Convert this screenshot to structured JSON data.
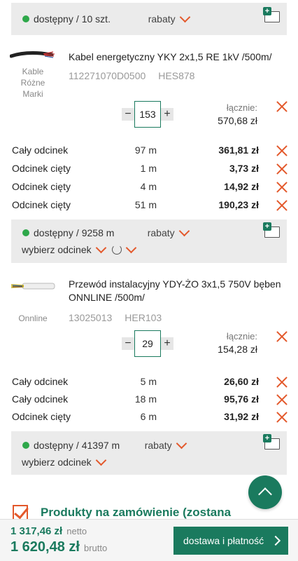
{
  "stock_bars": [
    {
      "status": "dostępny",
      "stock": "10 szt.",
      "discount": "rabaty"
    },
    {
      "status": "dostępny",
      "stock": "9258 m",
      "discount": "rabaty",
      "segment_select": "wybierz odcinek"
    },
    {
      "status": "dostępny",
      "stock": "41397 m",
      "discount": "rabaty",
      "segment_select": "wybierz odcinek"
    }
  ],
  "products": [
    {
      "name": "Kabel energetyczny YKY 2x1,5 RE 1kV /500m/",
      "brand": "Kable\nRóżne\nMarki",
      "code": "112271070D0500",
      "sku": "HES878",
      "quantity": "153",
      "total_label": "łącznie:",
      "total_value": "570,68 zł",
      "segments": [
        {
          "name": "Cały odcinek",
          "length": "97 m",
          "price": "361,81 zł"
        },
        {
          "name": "Odcinek cięty",
          "length": "1 m",
          "price": "3,73 zł"
        },
        {
          "name": "Odcinek cięty",
          "length": "4 m",
          "price": "14,92 zł"
        },
        {
          "name": "Odcinek cięty",
          "length": "51 m",
          "price": "190,23 zł"
        }
      ]
    },
    {
      "name": "Przewód instalacyjny YDY-ŻO 3x1,5 750V bęben ONNLINE /500m/",
      "brand": "Onnline",
      "code": "13025013",
      "sku": "HER103",
      "quantity": "29",
      "total_label": "łącznie:",
      "total_value": "154,28 zł",
      "segments": [
        {
          "name": "Cały odcinek",
          "length": "5 m",
          "price": "26,60 zł"
        },
        {
          "name": "Cały odcinek",
          "length": "18 m",
          "price": "95,76 zł"
        },
        {
          "name": "Odcinek cięty",
          "length": "6 m",
          "price": "31,92 zł"
        }
      ]
    }
  ],
  "order_section": {
    "title": "Produkty na zamówienie (zostana"
  },
  "footer": {
    "netto_value": "1 317,46 zł",
    "netto_label": "netto",
    "brutto_value": "1 620,48 zł",
    "brutto_label": "brutto",
    "checkout_label": "dostawa i płatność"
  },
  "colors": {
    "accent": "#1a7a5e",
    "danger": "#e3582b",
    "available": "#2ea84a"
  }
}
